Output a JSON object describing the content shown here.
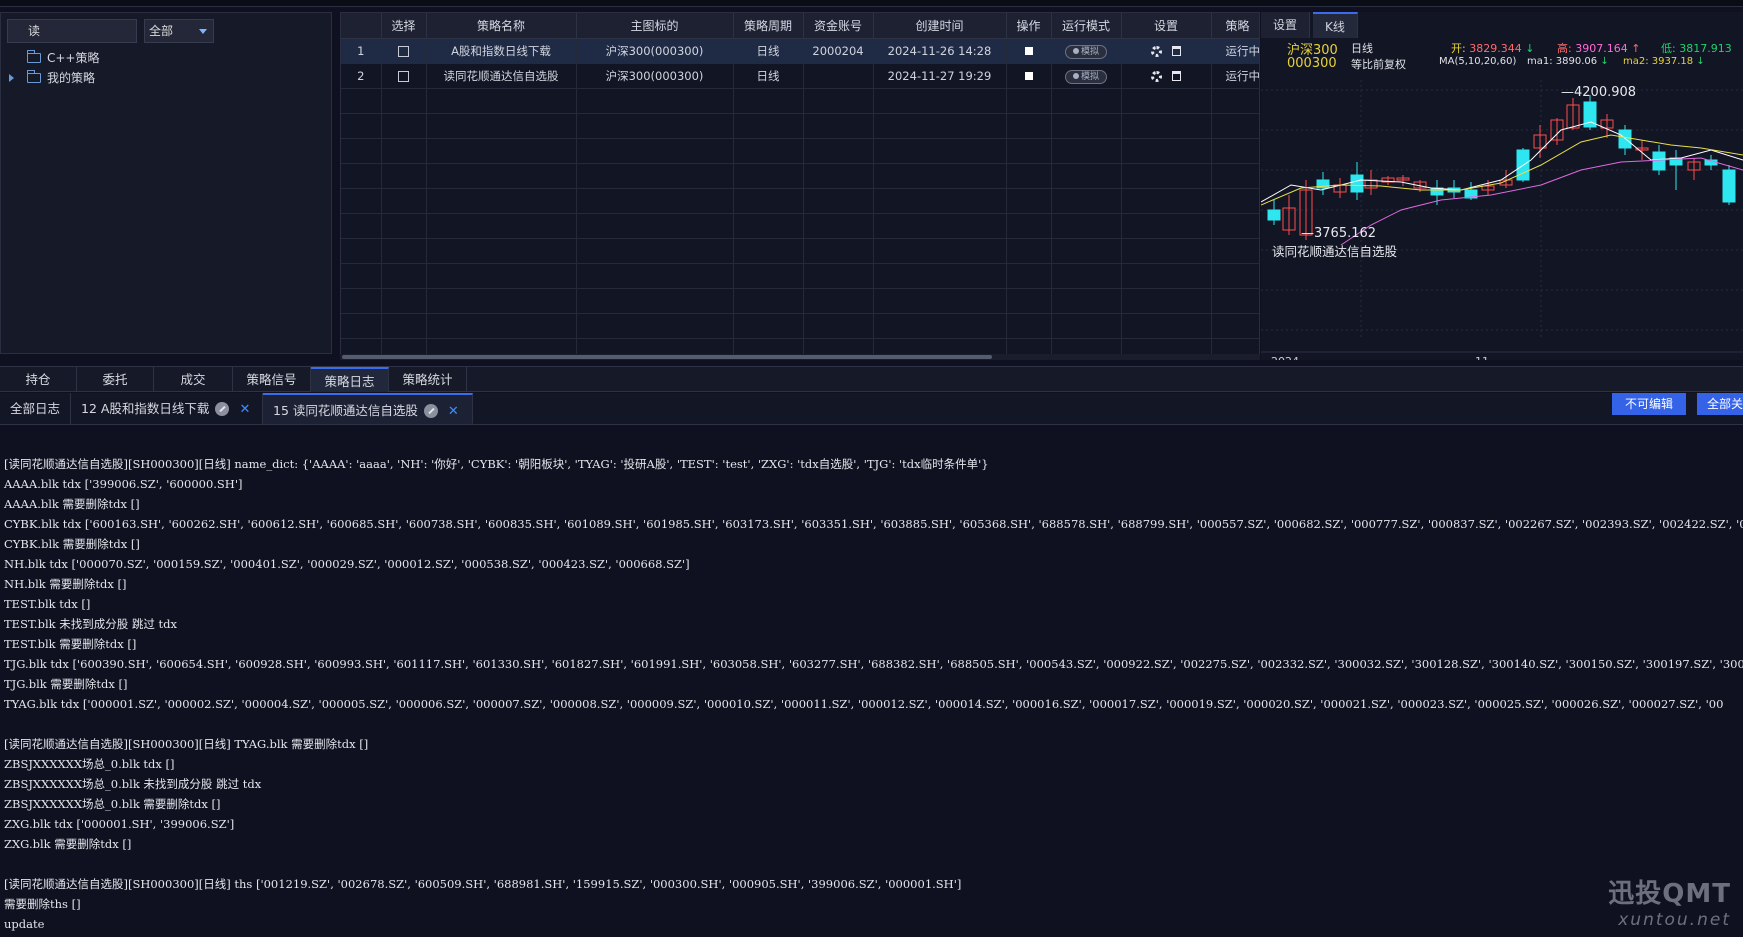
{
  "left": {
    "search_value": "读",
    "filter": "全部",
    "tree": [
      {
        "label": "C++策略"
      },
      {
        "label": "我的策略"
      }
    ]
  },
  "table": {
    "headers": [
      "",
      "选择",
      "策略名称",
      "主图标的",
      "策略周期",
      "资金账号",
      "创建时间",
      "操作",
      "运行模式",
      "设置",
      "策略状态"
    ],
    "header_visible_last": "策略",
    "rows": [
      {
        "no": "1",
        "name": "A股和指数日线下载",
        "symbol": "沪深300(000300)",
        "period": "日线",
        "account": "2000204",
        "created": "2024-11-26 14:28",
        "mode": "模拟",
        "status": "运行中"
      },
      {
        "no": "2",
        "name": "读同花顺通达信自选股",
        "symbol": "沪深300(000300)",
        "period": "日线",
        "account": "",
        "created": "2024-11-27 19:29",
        "mode": "模拟",
        "status": "运行中"
      }
    ]
  },
  "chart_panel": {
    "tabs": [
      "设置",
      "K线"
    ],
    "active_tab": "K线",
    "name": "沪深300",
    "code": "000300",
    "period": "日线",
    "adjust": "等比前复权",
    "ma_label": "MA(5,10,20,60)",
    "open_label": "开:",
    "open_value": "3829.344",
    "high_label": "高:",
    "high_value": "3907.164",
    "low_label": "低:",
    "low_value": "3817.913",
    "ma1_label": "ma1:",
    "ma1_value": "3890.06",
    "ma2_label": "ma2:",
    "ma2_value": "3937.18",
    "max_price": "4200.908",
    "min_price": "3765.162",
    "strategy_label": "读同花顺通达信自选股",
    "x_labels": [
      "2024",
      "11"
    ],
    "colors": {
      "up": "#ff4d4d",
      "down": "#2ee6f0",
      "ma5": "#ffffff",
      "ma10": "#e8e04a",
      "ma20": "#e06ae0"
    }
  },
  "bottom_tabs": [
    "持仓",
    "委托",
    "成交",
    "策略信号",
    "策略日志",
    "策略统计"
  ],
  "active_bottom_tab": "策略日志",
  "log_tabs": [
    {
      "label": "全部日志"
    },
    {
      "label": "12 A股和指数日线下载"
    },
    {
      "label": "15 读同花顺通达信自选股"
    }
  ],
  "buttons": {
    "readonly": "不可编辑",
    "close_all": "全部关"
  },
  "log_lines": [
    "",
    "[读同花顺通达信自选股][SH000300][日线] name_dict: {'AAAA': 'aaaa', 'NH': '你好', 'CYBK': '朝阳板块', 'TYAG': '投研A股', 'TEST': 'test', 'ZXG': 'tdx自选股', 'TJG': 'tdx临时条件单'}",
    "AAAA.blk tdx ['399006.SZ', '600000.SH']",
    "AAAA.blk 需要删除tdx []",
    "CYBK.blk tdx ['600163.SH', '600262.SH', '600612.SH', '600685.SH', '600738.SH', '600835.SH', '601089.SH', '601985.SH', '603173.SH', '603351.SH', '603885.SH', '605368.SH', '688578.SH', '688799.SH', '000557.SZ', '000682.SZ', '000777.SZ', '000837.SZ', '002267.SZ', '002393.SZ', '002422.SZ', '00",
    "CYBK.blk 需要删除tdx []",
    "NH.blk tdx ['000070.SZ', '000159.SZ', '000401.SZ', '000029.SZ', '000012.SZ', '000538.SZ', '000423.SZ', '000668.SZ']",
    "NH.blk 需要删除tdx []",
    "TEST.blk tdx []",
    "TEST.blk 未找到成分股 跳过 tdx",
    "TEST.blk 需要删除tdx []",
    "TJG.blk tdx ['600390.SH', '600654.SH', '600928.SH', '600993.SH', '601117.SH', '601330.SH', '601827.SH', '601991.SH', '603058.SH', '603277.SH', '688382.SH', '688505.SH', '000543.SZ', '000922.SZ', '002275.SZ', '002332.SZ', '300032.SZ', '300128.SZ', '300140.SZ', '300150.SZ', '300197.SZ', '300",
    "TJG.blk 需要删除tdx []",
    "TYAG.blk tdx ['000001.SZ', '000002.SZ', '000004.SZ', '000005.SZ', '000006.SZ', '000007.SZ', '000008.SZ', '000009.SZ', '000010.SZ', '000011.SZ', '000012.SZ', '000014.SZ', '000016.SZ', '000017.SZ', '000019.SZ', '000020.SZ', '000021.SZ', '000023.SZ', '000025.SZ', '000026.SZ', '000027.SZ', '00",
    "",
    "[读同花顺通达信自选股][SH000300][日线] TYAG.blk 需要删除tdx []",
    "ZBSJXXXXXX场总_0.blk tdx []",
    "ZBSJXXXXXX场总_0.blk 未找到成分股 跳过 tdx",
    "ZBSJXXXXXX场总_0.blk 需要删除tdx []",
    "ZXG.blk tdx ['000001.SH', '399006.SZ']",
    "ZXG.blk 需要删除tdx []",
    "",
    "[读同花顺通达信自选股][SH000300][日线] ths ['001219.SZ', '002678.SZ', '600509.SH', '688981.SH', '159915.SZ', '000300.SH', '000905.SH', '399006.SZ', '000001.SH']",
    "需要删除ths []",
    "update"
  ],
  "watermark": {
    "brand": "迅投QMT",
    "url": "xuntou.net"
  }
}
